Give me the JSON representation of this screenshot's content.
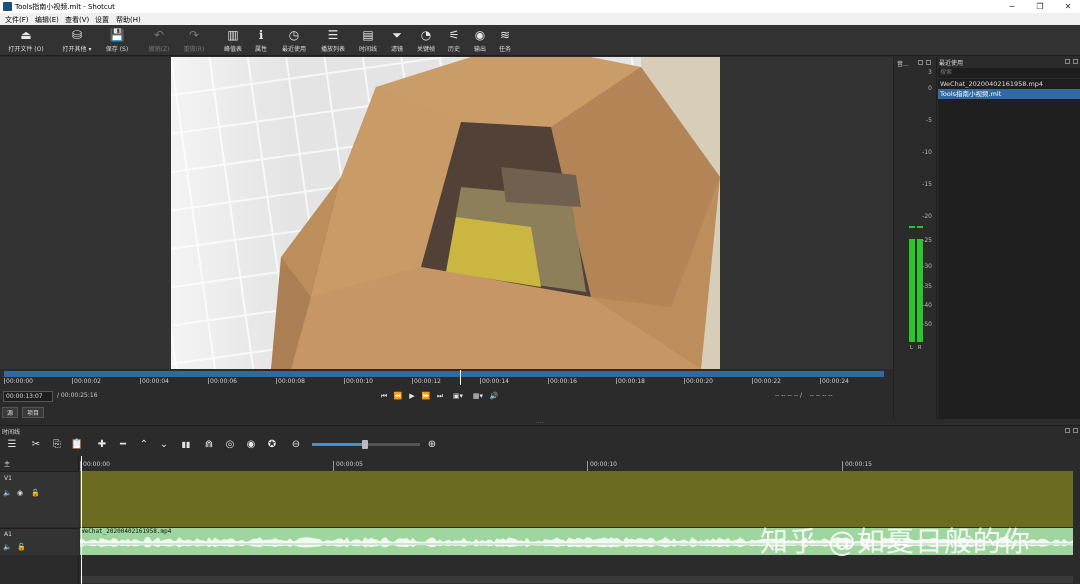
{
  "window": {
    "title": "Tools指南小视频.mlt - Shotcut",
    "controls": [
      "─",
      "❐",
      "✕"
    ]
  },
  "menu": [
    "文件(F)",
    "编辑(E)",
    "查看(V)",
    "设置",
    "帮助(H)"
  ],
  "toolbar": [
    {
      "icon": "open-file-icon",
      "glyph": "⏏",
      "label": "打开文件 (O)",
      "enabled": true
    },
    {
      "icon": "open-other-icon",
      "glyph": "⛁",
      "label": "打开其他 ▾",
      "enabled": true
    },
    {
      "icon": "save-icon",
      "glyph": "💾",
      "label": "保存 (S)",
      "enabled": true
    },
    {
      "icon": "undo-icon",
      "glyph": "↶",
      "label": "撤销(Z)",
      "enabled": false
    },
    {
      "icon": "redo-icon",
      "glyph": "↷",
      "label": "重做(R)",
      "enabled": false
    },
    {
      "icon": "peak-meter-icon",
      "glyph": "▥",
      "label": "峰值表",
      "enabled": true
    },
    {
      "icon": "properties-icon",
      "glyph": "ℹ",
      "label": "属性",
      "enabled": true
    },
    {
      "icon": "recent-icon",
      "glyph": "◷",
      "label": "最近使用",
      "enabled": true
    },
    {
      "icon": "playlist-icon",
      "glyph": "☰",
      "label": "播放列表",
      "enabled": true
    },
    {
      "icon": "timeline-icon",
      "glyph": "▤",
      "label": "时间线",
      "enabled": true
    },
    {
      "icon": "filter-icon",
      "glyph": "⏷",
      "label": "滤镜",
      "enabled": true
    },
    {
      "icon": "keyframes-icon",
      "glyph": "◔",
      "label": "关键帧",
      "enabled": true
    },
    {
      "icon": "history-icon",
      "glyph": "⚟",
      "label": "历史",
      "enabled": true
    },
    {
      "icon": "export-icon",
      "glyph": "◉",
      "label": "输出",
      "enabled": true
    },
    {
      "icon": "jobs-icon",
      "glyph": "≋",
      "label": "任务",
      "enabled": true
    }
  ],
  "player": {
    "ruler_ticks": [
      "00:00:00",
      "00:00:02",
      "00:00:04",
      "00:00:06",
      "00:00:08",
      "00:00:10",
      "00:00:12",
      "00:00:14",
      "00:00:16",
      "00:00:18",
      "00:00:20",
      "00:00:22",
      "00:00:24"
    ],
    "current_time": "00:00:13:07",
    "duration": "/ 00:00:25:16",
    "in_out": "-- -- -- -- /    -- -- -- --",
    "tabs": [
      "源",
      "项目"
    ],
    "transport": [
      "⏮",
      "⏪",
      "▶",
      "⏩",
      "⏭",
      "▣▾",
      "▦▾",
      "🔊"
    ]
  },
  "meter": {
    "header": "音...",
    "scale": [
      "3",
      "0",
      "-5",
      "-10",
      "-15",
      "-20",
      "-25",
      "-30",
      "-35",
      "-40",
      "-50"
    ],
    "channels": [
      "L",
      "R"
    ],
    "level_db": -25
  },
  "recent": {
    "title": "最近使用",
    "search_placeholder": "搜索",
    "items": [
      {
        "name": "WeChat_20200402161958.mp4",
        "selected": false
      },
      {
        "name": "Tools指南小视频.mlt",
        "selected": true
      }
    ]
  },
  "timeline": {
    "title": "时间线",
    "toolbar": [
      {
        "icon": "menu-icon",
        "glyph": "☰"
      },
      {
        "icon": "cut-icon",
        "glyph": "✂"
      },
      {
        "icon": "copy-icon",
        "glyph": "⎘"
      },
      {
        "icon": "paste-icon",
        "glyph": "📋"
      },
      {
        "icon": "append-icon",
        "glyph": "✚"
      },
      {
        "icon": "remove-icon",
        "glyph": "━"
      },
      {
        "icon": "lift-icon",
        "glyph": "⌃"
      },
      {
        "icon": "overwrite-icon",
        "glyph": "⌄"
      },
      {
        "icon": "split-icon",
        "glyph": "▮▮"
      },
      {
        "icon": "snap-icon",
        "glyph": "⋒"
      },
      {
        "icon": "scrub-icon",
        "glyph": "◎"
      },
      {
        "icon": "ripple-icon",
        "glyph": "◉"
      },
      {
        "icon": "ripple-all-icon",
        "glyph": "✪"
      },
      {
        "icon": "zoom-out-icon",
        "glyph": "⊖"
      },
      {
        "icon": "zoom-in-icon",
        "glyph": "⊕"
      }
    ],
    "zoom_level": 0.5,
    "master_label": "主",
    "ruler_ticks": [
      "00:00:00",
      "00:00:05",
      "00:00:10",
      "00:00:15"
    ],
    "tracks": [
      {
        "name": "V1",
        "icons": [
          "mute-icon",
          "eye-icon",
          "lock-icon"
        ]
      },
      {
        "name": "A1",
        "icons": [
          "mute-icon",
          "lock-icon"
        ]
      }
    ],
    "audio_clip": "WeChat_20200402161958.mp4"
  },
  "watermark": "知乎 @如夏日般的你"
}
